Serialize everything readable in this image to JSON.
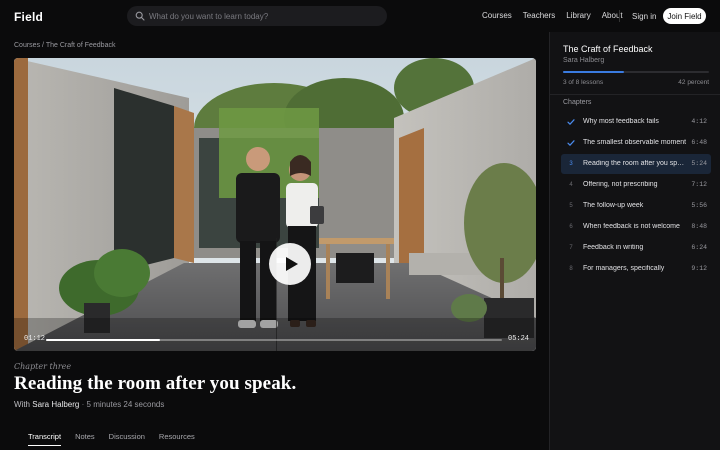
{
  "app": {
    "logo": "Field"
  },
  "search": {
    "placeholder": "What do you want to learn today?"
  },
  "nav": {
    "links": [
      "Courses",
      "Teachers",
      "Library",
      "About"
    ],
    "sign_in": "Sign in",
    "join": "Join Field"
  },
  "breadcrumb": {
    "course": "Courses",
    "separator": "/",
    "current": "The Craft of Feedback"
  },
  "player": {
    "current_time": "01:12",
    "total_time": "05:24",
    "progress_fraction": 0.25
  },
  "lesson": {
    "kicker": "Chapter three",
    "title": "Reading the room after you speak.",
    "author_prefix": "With",
    "author": "Sara Halberg",
    "separator": "·",
    "duration": "5 minutes 24 seconds"
  },
  "tabs": [
    "Transcript",
    "Notes",
    "Discussion",
    "Resources"
  ],
  "active_tab": "Transcript",
  "sidebar": {
    "course_title": "The Craft of Feedback",
    "author": "Sara Halberg",
    "progress_fraction": 0.42,
    "lessons_count": "3 of 8 lessons",
    "percent": "42 percent",
    "chapters_label": "Chapters",
    "chapters": [
      {
        "marker": "check",
        "title": "Why most feedback fails",
        "duration": "4:12"
      },
      {
        "marker": "check",
        "title": "The smallest observable moment",
        "duration": "6:48"
      },
      {
        "marker": "3",
        "title": "Reading the room after you speak",
        "duration": "5:24",
        "current": true
      },
      {
        "marker": "4",
        "title": "Offering, not prescribing",
        "duration": "7:12"
      },
      {
        "marker": "5",
        "title": "The follow-up week",
        "duration": "5:56"
      },
      {
        "marker": "6",
        "title": "When feedback is not welcome",
        "duration": "8:48"
      },
      {
        "marker": "7",
        "title": "Feedback in writing",
        "duration": "6:24"
      },
      {
        "marker": "8",
        "title": "For managers, specifically",
        "duration": "9:12"
      }
    ]
  },
  "colors": {
    "accent": "#3a7be0",
    "current_row": "#1a2638",
    "check": "#4b8cf0"
  }
}
